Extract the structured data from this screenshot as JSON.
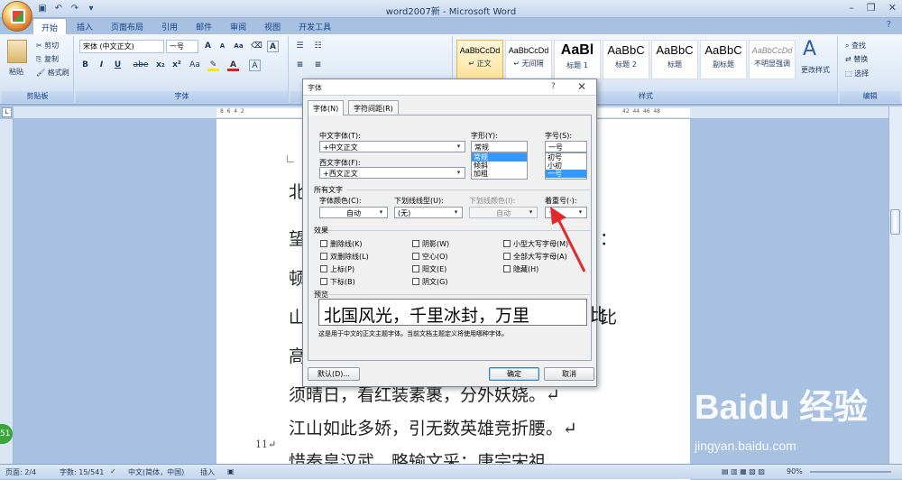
{
  "window": {
    "title": "word2007新 - Microsoft Word",
    "min": "–",
    "restore": "❐",
    "close": "✕"
  },
  "qat": {
    "save": "▣",
    "undo": "↶",
    "redo": "↷",
    "more": "▾"
  },
  "tabs": [
    "开始",
    "插入",
    "页面布局",
    "引用",
    "邮件",
    "审阅",
    "视图",
    "开发工具"
  ],
  "ribbon": {
    "clipboard": {
      "group": "剪贴板",
      "paste": "粘贴",
      "cut": "剪切",
      "copy": "复制",
      "format_painter": "格式刷"
    },
    "font": {
      "group": "字体",
      "font_name": "宋体 (中文正文)",
      "font_size": "一号",
      "bold": "B",
      "italic": "I",
      "underline": "U",
      "strike": "abe",
      "sub": "x₂",
      "sup": "x²",
      "aa": "Aa",
      "grow": "A",
      "shrink": "A"
    },
    "paragraph": {
      "group": "段落"
    },
    "styles": {
      "group": "样式",
      "items": [
        {
          "sample": "AaBbCcDd",
          "name": "↵ 正文"
        },
        {
          "sample": "AaBbCcDd",
          "name": "↵ 无间隔"
        },
        {
          "sample": "AaBl",
          "name": "标题 1"
        },
        {
          "sample": "AaBbC",
          "name": "标题 2"
        },
        {
          "sample": "AaBbC",
          "name": "标题"
        },
        {
          "sample": "AaBbC",
          "name": "副标题"
        },
        {
          "sample": "AaBbCcDd",
          "name": "不明显强调"
        }
      ],
      "change": "更改样式"
    },
    "editing": {
      "group": "编辑",
      "find": "查找",
      "replace": "替换",
      "select": "选择"
    }
  },
  "ruler": {
    "left": "8  6  4  2",
    "right": "42  44  46  48"
  },
  "document": {
    "lines": [
      "北",
      "望",
      "顿",
      "山",
      "高",
      "须晴日，看红装素裹，分外妖娆。↵",
      "江山如此多娇，引无数英雄竞折腰。↵",
      "惜秦皇汉武，略输文采；唐宗宋祖，"
    ],
    "right_frag": [
      "：",
      "▾",
      "比"
    ],
    "line_number": "11↵"
  },
  "dialog": {
    "title": "字体",
    "help": "?",
    "close": "✕",
    "tabs": [
      "字体(N)",
      "字符间距(R)"
    ],
    "cn_font_label": "中文字体(T):",
    "cn_font_value": "+中文正文",
    "west_font_label": "西文字体(F):",
    "west_font_value": "+西文正文",
    "style_label": "字形(Y):",
    "style_value": "常规",
    "style_list": [
      "常规",
      "倾斜",
      "加粗"
    ],
    "size_label": "字号(S):",
    "size_value": "一号",
    "size_list": [
      "初号",
      "小初",
      "一号"
    ],
    "all_text": "所有文字",
    "color_label": "字体颜色(C):",
    "color_value": "自动",
    "underline_label": "下划线线型(U):",
    "underline_value": "(无)",
    "underline_color_label": "下划线颜色(I):",
    "underline_color_value": "自动",
    "emphasis_label": "着重号(·):",
    "emphasis_value": "·",
    "effects": "效果",
    "effects_list": [
      "删除线(K)",
      "阴影(W)",
      "小型大写字母(M)",
      "双删除线(L)",
      "空心(O)",
      "全部大写字母(A)",
      "上标(P)",
      "阳文(E)",
      "隐藏(H)",
      "下标(B)",
      "阴文(G)"
    ],
    "preview_label": "预览",
    "preview_text": "北国风光，千里冰封，万里",
    "preview_overflow": "比",
    "note": "这是用于中文的正文主题字体。当前文档主题定义将使用哪种字体。",
    "default_btn": "默认(D)...",
    "ok_btn": "确定",
    "cancel_btn": "取消"
  },
  "status": {
    "page": "页面: 2/4",
    "words": "字数: 15/541",
    "lang": "中文(简体，中国)",
    "insert": "插入",
    "zoom": "90%"
  },
  "watermark": {
    "brand": "Baidu 经验",
    "url": "jingyan.baidu.com",
    "badge": "51"
  }
}
